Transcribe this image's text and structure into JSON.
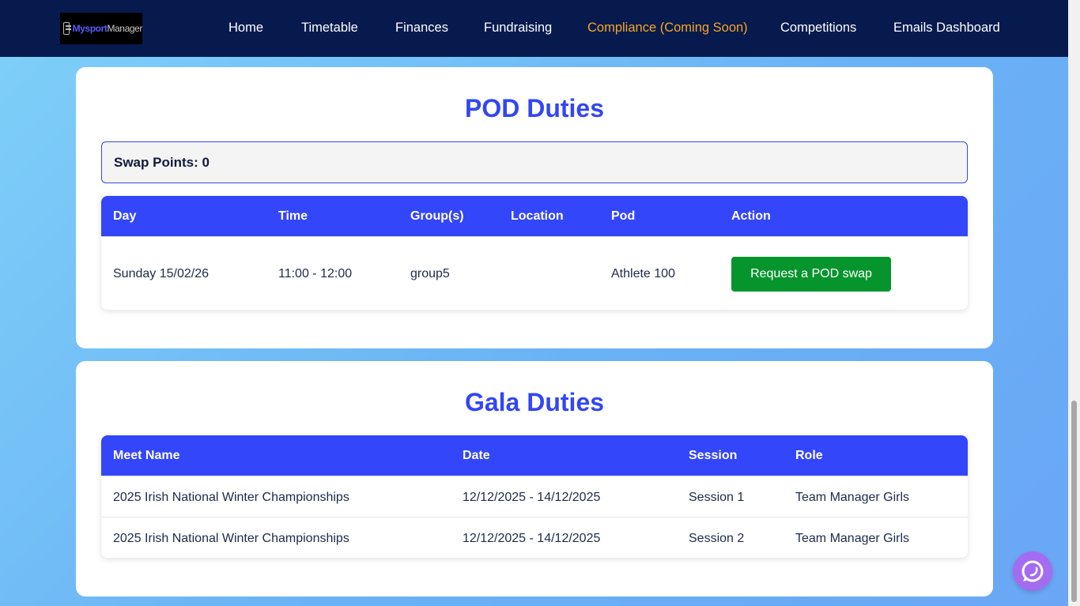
{
  "nav": {
    "logo": {
      "part1": "Mysport",
      "part2": "Manager"
    },
    "items": [
      {
        "label": "Home",
        "active": false
      },
      {
        "label": "Timetable",
        "active": false
      },
      {
        "label": "Finances",
        "active": false
      },
      {
        "label": "Fundraising",
        "active": false
      },
      {
        "label": "Compliance (Coming Soon)",
        "active": true
      },
      {
        "label": "Competitions",
        "active": false
      },
      {
        "label": "Emails Dashboard",
        "active": false
      }
    ]
  },
  "pod": {
    "title": "POD Duties",
    "swap_points": "Swap Points: 0",
    "columns": [
      "Day",
      "Time",
      "Group(s)",
      "Location",
      "Pod",
      "Action"
    ],
    "rows": [
      {
        "day": "Sunday 15/02/26",
        "time": "11:00 - 12:00",
        "groups": "group5",
        "location": "",
        "pod": "Athlete 100",
        "action": "Request a POD swap"
      }
    ]
  },
  "gala": {
    "title": "Gala Duties",
    "columns": [
      "Meet Name",
      "Date",
      "Session",
      "Role"
    ],
    "rows": [
      {
        "meet": "2025 Irish National Winter Championships",
        "date": "12/12/2025 - 14/12/2025",
        "session": "Session 1",
        "role": "Team Manager Girls"
      },
      {
        "meet": "2025 Irish National Winter Championships",
        "date": "12/12/2025 - 14/12/2025",
        "session": "Session 2",
        "role": "Team Manager Girls"
      }
    ]
  },
  "colors": {
    "nav_bg": "#071a4e",
    "accent": "#3346fa",
    "active_nav": "#f5a623",
    "button_green": "#06952d",
    "chat": "#a46cf0"
  },
  "icons": {
    "chat": "chat-bubble-icon",
    "logo": "app-logo-icon"
  }
}
